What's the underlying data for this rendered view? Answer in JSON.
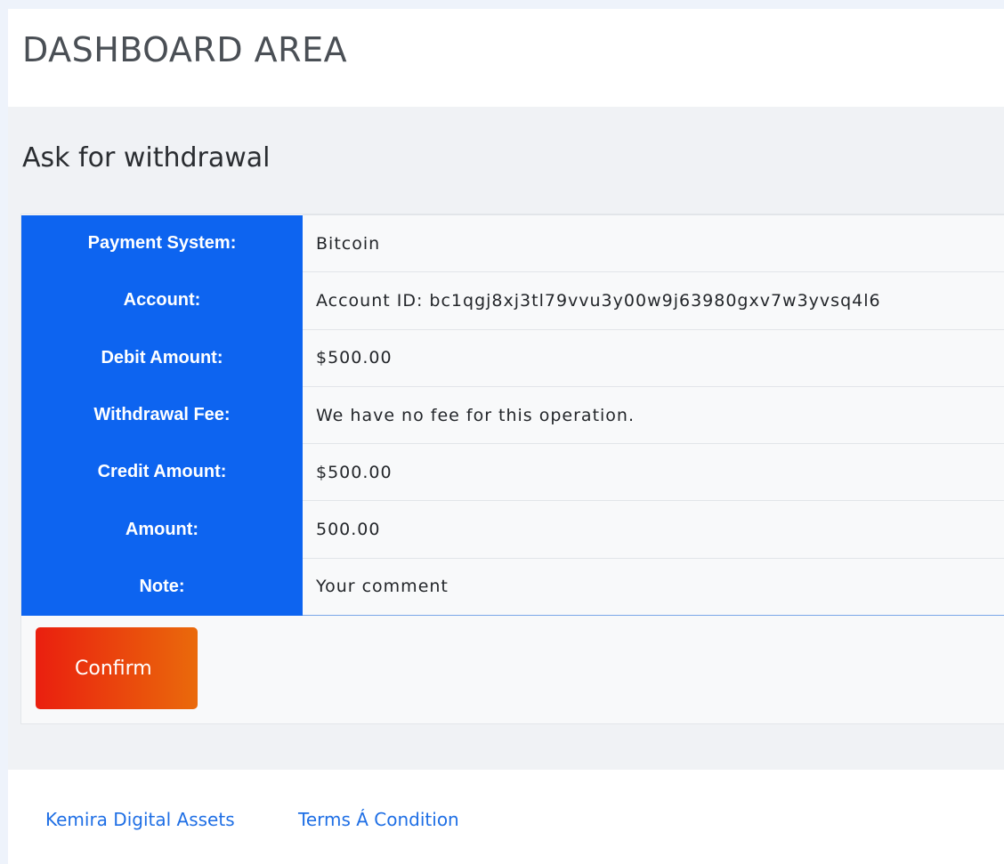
{
  "header": {
    "title": "DASHBOARD AREA"
  },
  "page": {
    "title": "Ask for withdrawal"
  },
  "details": [
    {
      "label": "Payment System:",
      "value": "Bitcoin"
    },
    {
      "label": "Account:",
      "value": "Account ID: bc1qgj8xj3tl79vvu3y00w9j63980gxv7w3yvsq4l6"
    },
    {
      "label": "Debit Amount:",
      "value": "$500.00"
    },
    {
      "label": "Withdrawal Fee:",
      "value": "We have no fee for this operation."
    },
    {
      "label": "Credit Amount:",
      "value": "$500.00"
    },
    {
      "label": "Amount:",
      "value": "500.00"
    },
    {
      "label": "Note:",
      "value": "Your comment"
    }
  ],
  "actions": {
    "confirm_label": "Confirm"
  },
  "footer": {
    "links": [
      {
        "label": "Kemira Digital Assets"
      },
      {
        "label": "Terms Á Condition"
      }
    ]
  },
  "colors": {
    "label_bg": "#0d64f0",
    "button_gradient_start": "#ea1f0f",
    "button_gradient_end": "#ea6a0b",
    "link": "#1f6fe5"
  }
}
